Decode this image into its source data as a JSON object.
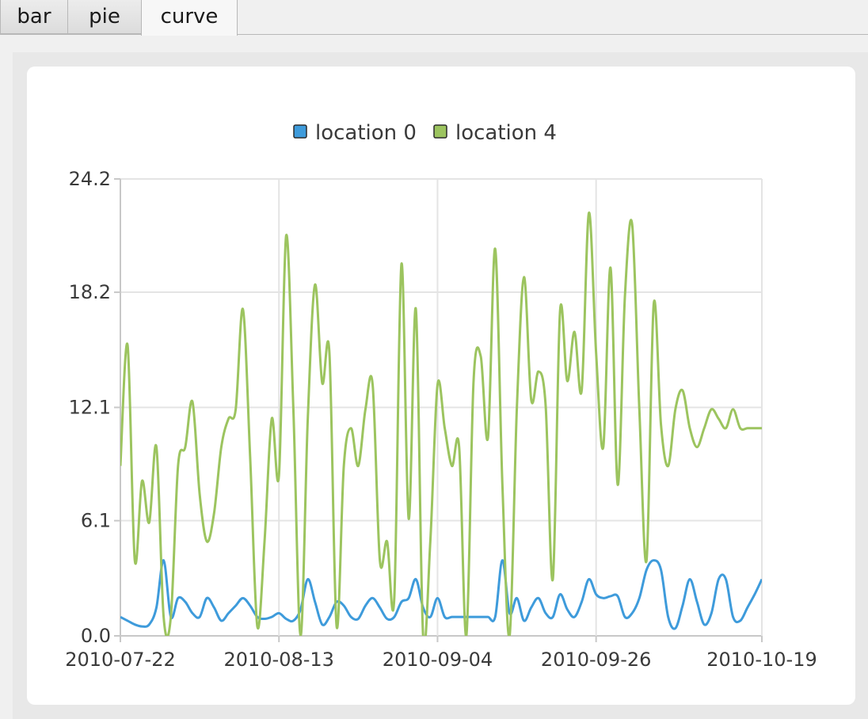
{
  "tabs": [
    {
      "label": "bar"
    },
    {
      "label": "pie"
    },
    {
      "label": "curve"
    }
  ],
  "active_tab": "curve",
  "colors": {
    "location0": "#3e9bdb",
    "location4": "#9cc45f",
    "grid": "#e4e4e4",
    "axis": "#c8c8c8"
  },
  "chart_data": {
    "type": "line",
    "smooth": true,
    "legend_position": "top-center",
    "grid": true,
    "xlim": [
      "2010-07-22",
      "2010-10-19"
    ],
    "ylim": [
      0.0,
      24.2
    ],
    "x_ticks": [
      "2010-07-22",
      "2010-08-13",
      "2010-09-04",
      "2010-09-26",
      "2010-10-19"
    ],
    "y_ticks": [
      "0.0",
      "6.1",
      "12.1",
      "18.2",
      "24.2"
    ],
    "x": [
      "2010-07-22",
      "2010-07-23",
      "2010-07-24",
      "2010-07-25",
      "2010-07-26",
      "2010-07-27",
      "2010-07-28",
      "2010-07-29",
      "2010-07-30",
      "2010-07-31",
      "2010-08-01",
      "2010-08-02",
      "2010-08-03",
      "2010-08-04",
      "2010-08-05",
      "2010-08-06",
      "2010-08-07",
      "2010-08-08",
      "2010-08-09",
      "2010-08-10",
      "2010-08-11",
      "2010-08-12",
      "2010-08-13",
      "2010-08-14",
      "2010-08-15",
      "2010-08-16",
      "2010-08-17",
      "2010-08-18",
      "2010-08-19",
      "2010-08-20",
      "2010-08-21",
      "2010-08-22",
      "2010-08-23",
      "2010-08-24",
      "2010-08-25",
      "2010-08-26",
      "2010-08-27",
      "2010-08-28",
      "2010-08-29",
      "2010-08-30",
      "2010-08-31",
      "2010-09-01",
      "2010-09-02",
      "2010-09-03",
      "2010-09-04",
      "2010-09-05",
      "2010-09-06",
      "2010-09-07",
      "2010-09-08",
      "2010-09-09",
      "2010-09-10",
      "2010-09-11",
      "2010-09-12",
      "2010-09-13",
      "2010-09-14",
      "2010-09-15",
      "2010-09-16",
      "2010-09-17",
      "2010-09-18",
      "2010-09-19",
      "2010-09-20",
      "2010-09-21",
      "2010-09-22",
      "2010-09-23",
      "2010-09-24",
      "2010-09-25",
      "2010-09-26",
      "2010-09-27",
      "2010-09-28",
      "2010-09-29",
      "2010-09-30",
      "2010-10-01",
      "2010-10-02",
      "2010-10-03",
      "2010-10-04",
      "2010-10-05",
      "2010-10-06",
      "2010-10-07",
      "2010-10-08",
      "2010-10-09",
      "2010-10-10",
      "2010-10-11",
      "2010-10-12",
      "2010-10-13",
      "2010-10-14",
      "2010-10-15",
      "2010-10-16",
      "2010-10-17",
      "2010-10-18",
      "2010-10-19"
    ],
    "series": [
      {
        "name": "location 0",
        "values": [
          1.0,
          0.8,
          0.6,
          0.5,
          0.6,
          1.5,
          4.0,
          1.0,
          2.0,
          1.8,
          1.2,
          1.0,
          2.0,
          1.5,
          0.8,
          1.2,
          1.6,
          2.0,
          1.6,
          1.0,
          0.9,
          1.0,
          1.2,
          0.9,
          0.8,
          1.4,
          3.0,
          1.8,
          0.6,
          1.0,
          1.8,
          1.6,
          1.0,
          0.9,
          1.6,
          2.0,
          1.5,
          0.9,
          1.0,
          1.8,
          2.0,
          3.0,
          1.5,
          1.0,
          2.0,
          1.0,
          1.0,
          1.0,
          1.0,
          1.0,
          1.0,
          1.0,
          1.0,
          4.0,
          1.2,
          2.0,
          0.8,
          1.5,
          2.0,
          1.2,
          1.0,
          2.2,
          1.4,
          1.0,
          1.8,
          3.0,
          2.2,
          2.0,
          2.1,
          2.1,
          1.0,
          1.2,
          2.0,
          3.5,
          4.0,
          3.5,
          1.0,
          0.4,
          1.6,
          3.0,
          1.8,
          0.6,
          1.2,
          3.0,
          3.0,
          1.0,
          0.8,
          1.5,
          2.2,
          3.0
        ]
      },
      {
        "name": "location 4",
        "values": [
          9.0,
          15.4,
          4.0,
          8.2,
          6.0,
          10.0,
          1.0,
          1.0,
          9.0,
          10.0,
          12.4,
          7.5,
          5.0,
          6.5,
          10.0,
          11.5,
          12.0,
          17.3,
          9.5,
          0.5,
          5.0,
          11.5,
          8.5,
          21.2,
          12.0,
          0.0,
          11.5,
          18.6,
          13.4,
          15.0,
          0.5,
          9.0,
          11.0,
          9.0,
          12.0,
          13.3,
          4.0,
          5.0,
          2.0,
          19.7,
          6.2,
          17.3,
          0.0,
          5.0,
          13.3,
          11.0,
          9.0,
          10.0,
          0.0,
          13.5,
          14.8,
          10.5,
          20.5,
          8.0,
          0.0,
          12.0,
          19.0,
          12.5,
          14.0,
          12.2,
          3.0,
          17.2,
          13.5,
          16.1,
          13.0,
          22.4,
          15.0,
          10.0,
          19.5,
          8.0,
          18.0,
          21.8,
          12.0,
          4.0,
          17.6,
          11.2,
          9.0,
          12.0,
          13.0,
          11.0,
          10.0,
          11.0,
          12.0,
          11.5,
          11.0,
          12.0,
          11.0,
          11.0,
          11.0,
          11.0
        ]
      }
    ]
  }
}
